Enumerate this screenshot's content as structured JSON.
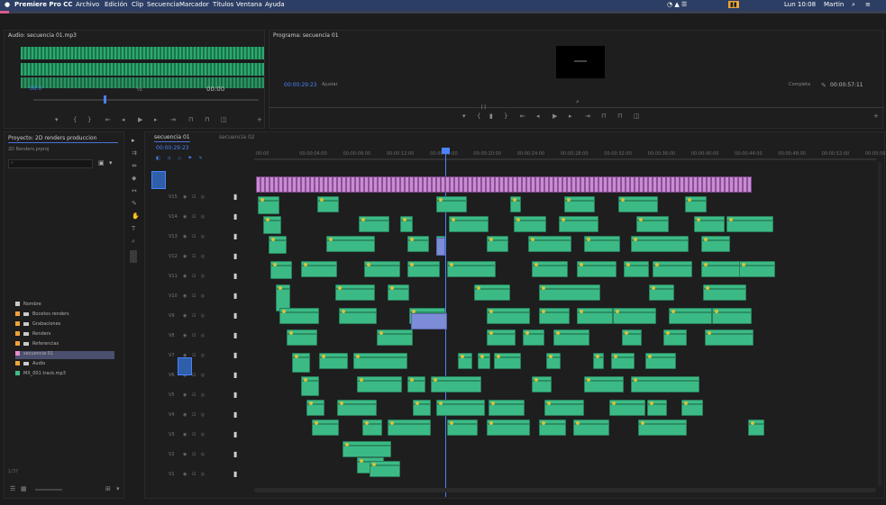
{
  "menubar": {
    "apple": "",
    "app": "Premiere Pro CC",
    "items": [
      "Archivo",
      "Edición",
      "Clip",
      "Secuencia",
      "Marcador",
      "Títulos",
      "Ventana",
      "Ayuda"
    ],
    "clock": "Lun 10:08",
    "user": "Martin"
  },
  "source_monitor": {
    "title": "Audio: secuencia 01.mp3",
    "timecode": "00:0",
    "zoom": "½",
    "duration": "00:00"
  },
  "program_monitor": {
    "title": "Programa: secuencia 01",
    "timecode": "00:00:29:23",
    "fit": "Ajustar",
    "quality": "Completa",
    "duration": "00:00:57:11"
  },
  "project_panel": {
    "title": "Proyecto: 2D renders produccion",
    "file": "2D Renders.prproj",
    "search_placeholder": "",
    "footer": "1/37",
    "bins": [
      {
        "label": "Nombre",
        "color": "#c9c9c9",
        "type": "header"
      },
      {
        "label": "Bocetos renders",
        "color": "#f0a13a",
        "type": "folder"
      },
      {
        "label": "Grabaciones",
        "color": "#f0a13a",
        "type": "folder"
      },
      {
        "label": "Renders",
        "color": "#f0a13a",
        "type": "folder"
      },
      {
        "label": "Referencias",
        "color": "#f0a13a",
        "type": "folder"
      },
      {
        "label": "secuencia 01",
        "color": "#e68ad0",
        "type": "item"
      },
      {
        "label": "Audio",
        "color": "#f0a13a",
        "type": "folder"
      },
      {
        "label": "MX_001 track.mp3",
        "color": "#3fbf86",
        "type": "item"
      }
    ]
  },
  "timeline": {
    "tab": "secuencia 01",
    "tab2": "secuencia 02",
    "timecode": "00:00:29:23",
    "ruler": [
      "00:00",
      "00:00:04:00",
      "00:00:08:00",
      "00:00:12:00",
      "00:00:16:00",
      "00:00:20:00",
      "00:00:24:00",
      "00:00:28:00",
      "00:00:32:00",
      "00:00:36:00",
      "00:00:40:00",
      "00:00:44:00",
      "00:00:48:00",
      "00:00:52:00",
      "00:00:56:00"
    ],
    "tracks": [
      "V15",
      "V14",
      "V13",
      "V12",
      "V11",
      "V10",
      "V9",
      "V8",
      "V7",
      "V6",
      "V5",
      "V4",
      "V3",
      "V2",
      "V1"
    ]
  },
  "colors": {
    "clip": "#3cba86",
    "audio": "#c78bd0",
    "accent": "#4a82ff"
  }
}
